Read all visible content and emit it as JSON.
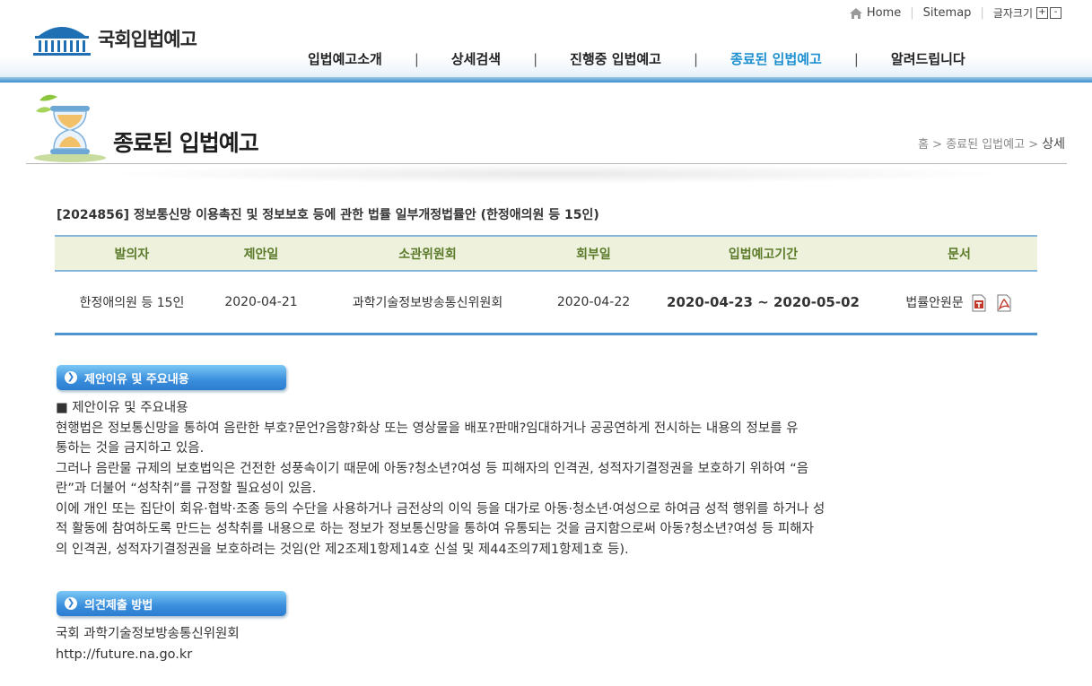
{
  "util": {
    "home": "Home",
    "sitemap": "Sitemap",
    "font_size": "글자크기",
    "zoom_in": "+",
    "zoom_out": "-"
  },
  "logo": {
    "text": "국회입법예고"
  },
  "gnb": [
    {
      "label": "입법예고소개"
    },
    {
      "label": "상세검색"
    },
    {
      "label": "진행중 입법예고"
    },
    {
      "label": "종료된 입법예고"
    },
    {
      "label": "알려드립니다"
    }
  ],
  "gnb_sep": "|",
  "page": {
    "title": "종료된 입법예고",
    "breadcrumb": [
      "홈",
      "종료된 입법예고",
      "상세"
    ],
    "breadcrumb_sep": ">"
  },
  "bill": {
    "title": "[2024856] 정보통신망 이용촉진 및 정보보호 등에 관한 법률 일부개정법률안 (한정애의원 등 15인)",
    "columns": [
      "발의자",
      "제안일",
      "소관위원회",
      "회부일",
      "입법예고기간",
      "문서"
    ],
    "row": {
      "proposer": "한정애의원 등 15인",
      "proposal_date": "2020-04-21",
      "committee": "과학기술정보방송통신위원회",
      "referral_date": "2020-04-22",
      "period": "2020-04-23 ~ 2020-05-02",
      "document": "법률안원문"
    }
  },
  "section1": {
    "button": "제안이유 및 주요내용",
    "heading": "■ 제안이유 및 주요내용",
    "lines": [
      "현행법은 정보통신망을 통하여 음란한 부호?문언?음향?화상 또는 영상물을 배포?판매?임대하거나 공공연하게 전시하는 내용의 정보를 유",
      "통하는 것을 금지하고 있음.",
      "그러나 음란물 규제의 보호법익은 건전한 성풍속이기 때문에 아동?청소년?여성 등 피해자의 인격권, 성적자기결정권을 보호하기 위하여 “음",
      "란”과 더불어 “성착취”를 규정할 필요성이 있음.",
      "이에 개인 또는 집단이 회유·협박·조종 등의 수단을 사용하거나 금전상의 이익 등을 대가로 아동·청소년·여성으로 하여금 성적 행위를 하거나 성",
      "적 활동에 참여하도록 만드는 성착취를 내용으로 하는 정보가 정보통신망을 통하여 유통되는 것을 금지함으로써 아동?청소년?여성 등 피해자",
      "의 인격권, 성적자기결정권을 보호하려는 것임(안 제2조제1항제14호 신설 및 제44조의7제1항제1호 등)."
    ]
  },
  "section2": {
    "button": "의견제출 방법",
    "lines": [
      "국회 과학기술정보방송통신위원회",
      "http://future.na.go.kr"
    ]
  }
}
